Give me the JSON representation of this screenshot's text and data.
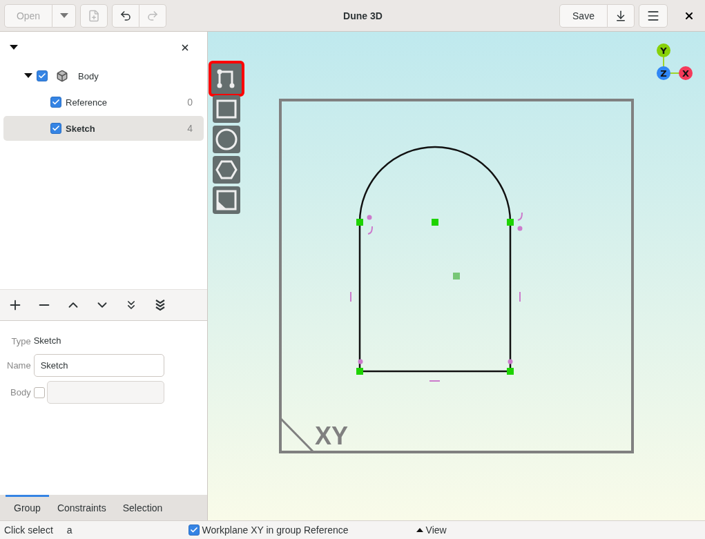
{
  "window": {
    "title": "Dune 3D"
  },
  "header": {
    "open_label": "Open",
    "open_disabled": true,
    "new_disabled": true,
    "undo_disabled": false,
    "redo_disabled": true,
    "save_label": "Save"
  },
  "tree": {
    "items": [
      {
        "label": "Body",
        "kind": "body",
        "checked": true,
        "expanded": true,
        "selected": false,
        "children": [
          {
            "label": "Reference",
            "count": "0",
            "checked": true,
            "selected": false
          },
          {
            "label": "Sketch",
            "count": "4",
            "checked": true,
            "selected": true
          }
        ]
      }
    ]
  },
  "properties": {
    "type_label": "Type",
    "type_value": "Sketch",
    "name_label": "Name",
    "name_value": "Sketch",
    "body_label": "Body",
    "body_checked": false
  },
  "tabs": [
    {
      "label": "Group",
      "selected": true
    },
    {
      "label": "Constraints",
      "selected": false
    },
    {
      "label": "Selection",
      "selected": false
    }
  ],
  "tools": [
    {
      "kind": "polyline",
      "selected": true
    },
    {
      "kind": "rectangle",
      "selected": false
    },
    {
      "kind": "circle",
      "selected": false
    },
    {
      "kind": "hexagon",
      "selected": false
    },
    {
      "kind": "corner",
      "selected": false
    }
  ],
  "viewport": {
    "workplane_label": "XY",
    "axes": [
      {
        "label": "Y"
      },
      {
        "label": "Z"
      },
      {
        "label": "X"
      }
    ]
  },
  "status_bar": {
    "hint": "Click select",
    "key": "a",
    "workplane_checked": true,
    "workplane_label": "Workplane XY in group Reference",
    "view_label": "View"
  }
}
